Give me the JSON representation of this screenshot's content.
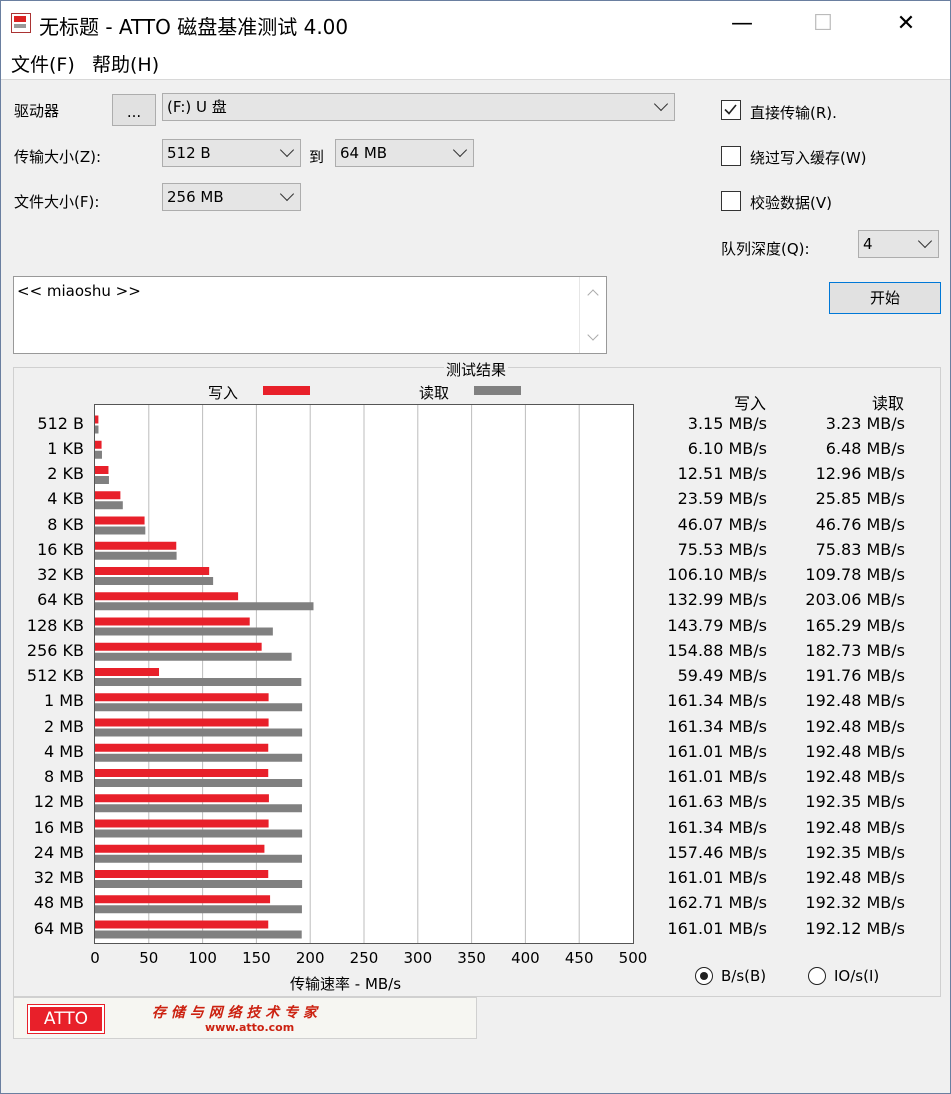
{
  "window": {
    "title": "无标题 - ATTO 磁盘基准测试 4.00",
    "minimize": "—",
    "maximize": "☐",
    "close": "✕"
  },
  "menu": {
    "file": "文件(F)",
    "help": "帮助(H)"
  },
  "drive": {
    "label": "驱动器",
    "browse": "...",
    "value": "(F:) U 盘"
  },
  "transfer": {
    "label": "传输大小(Z):",
    "from": "512 B",
    "to_label": "到",
    "to": "64 MB"
  },
  "filesize": {
    "label": "文件大小(F):",
    "value": "256 MB"
  },
  "options": {
    "direct_io": {
      "label": "直接传输(R).",
      "checked": true
    },
    "bypass_cache": {
      "label": "绕过写入缓存(W)",
      "checked": false
    },
    "verify": {
      "label": "校验数据(V)",
      "checked": false
    },
    "queue_label": "队列深度(Q):",
    "queue_value": "4",
    "start": "开始"
  },
  "description": "<< miaoshu >>",
  "results": {
    "title": "测试结果",
    "legend_write": "写入",
    "legend_read": "读取",
    "col_write": "写入",
    "col_read": "读取",
    "unit_radio_bytes": "B/s(B)",
    "unit_radio_io": "IO/s(I)",
    "selected_unit": "B/s(B)"
  },
  "colors": {
    "write": "#e8202a",
    "read": "#808080"
  },
  "chart_data": {
    "type": "bar",
    "orientation": "horizontal",
    "xlabel": "传输速率 - MB/s",
    "xlim": [
      0,
      500
    ],
    "xticks": [
      0,
      50,
      100,
      150,
      200,
      250,
      300,
      350,
      400,
      450,
      500
    ],
    "grid": true,
    "categories": [
      "512 B",
      "1 KB",
      "2 KB",
      "4 KB",
      "8 KB",
      "16 KB",
      "32 KB",
      "64 KB",
      "128 KB",
      "256 KB",
      "512 KB",
      "1 MB",
      "2 MB",
      "4 MB",
      "8 MB",
      "12 MB",
      "16 MB",
      "24 MB",
      "32 MB",
      "48 MB",
      "64 MB"
    ],
    "series": [
      {
        "name": "写入",
        "values": [
          3.15,
          6.1,
          12.51,
          23.59,
          46.07,
          75.53,
          106.1,
          132.99,
          143.79,
          154.88,
          59.49,
          161.34,
          161.34,
          161.01,
          161.01,
          161.63,
          161.34,
          157.46,
          161.01,
          162.71,
          161.01
        ],
        "labels": [
          "3.15 MB/s",
          "6.10 MB/s",
          "12.51 MB/s",
          "23.59 MB/s",
          "46.07 MB/s",
          "75.53 MB/s",
          "106.10 MB/s",
          "132.99 MB/s",
          "143.79 MB/s",
          "154.88 MB/s",
          "59.49 MB/s",
          "161.34 MB/s",
          "161.34 MB/s",
          "161.01 MB/s",
          "161.01 MB/s",
          "161.63 MB/s",
          "161.34 MB/s",
          "157.46 MB/s",
          "161.01 MB/s",
          "162.71 MB/s",
          "161.01 MB/s"
        ]
      },
      {
        "name": "读取",
        "values": [
          3.23,
          6.48,
          12.96,
          25.85,
          46.76,
          75.83,
          109.78,
          203.06,
          165.29,
          182.73,
          191.76,
          192.48,
          192.48,
          192.48,
          192.48,
          192.35,
          192.48,
          192.35,
          192.48,
          192.32,
          192.12
        ],
        "labels": [
          "3.23 MB/s",
          "6.48 MB/s",
          "12.96 MB/s",
          "25.85 MB/s",
          "46.76 MB/s",
          "75.83 MB/s",
          "109.78 MB/s",
          "203.06 MB/s",
          "165.29 MB/s",
          "182.73 MB/s",
          "191.76 MB/s",
          "192.48 MB/s",
          "192.48 MB/s",
          "192.48 MB/s",
          "192.48 MB/s",
          "192.35 MB/s",
          "192.48 MB/s",
          "192.35 MB/s",
          "192.48 MB/s",
          "192.32 MB/s",
          "192.12 MB/s"
        ]
      }
    ]
  },
  "banner": {
    "logo": "ATTO",
    "slogan": "存 储 与 网 络 技 术 专 家",
    "url": "www.atto.com"
  }
}
